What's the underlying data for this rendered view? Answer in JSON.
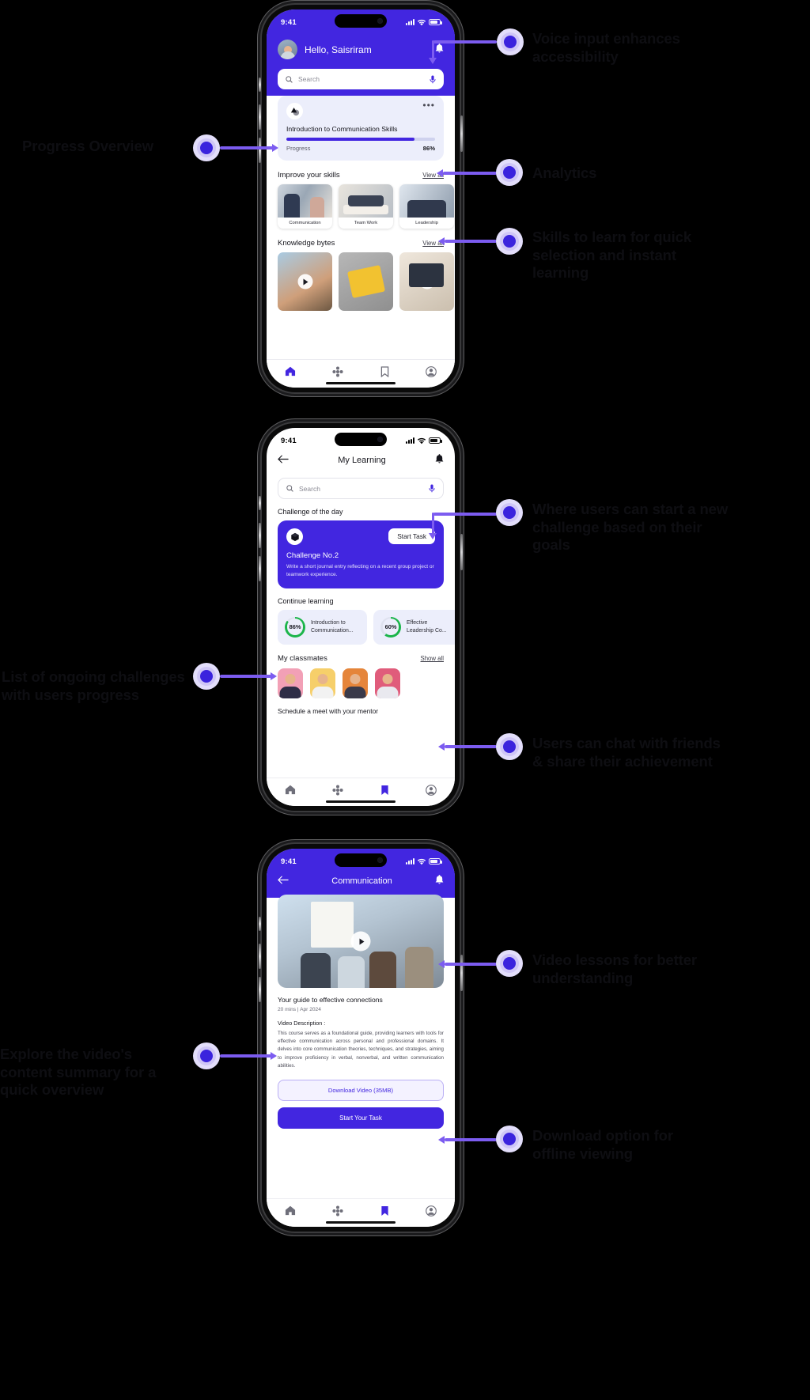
{
  "statusbar": {
    "time": "9:41"
  },
  "screen1": {
    "greeting": "Hello, Saisriram",
    "search_placeholder": "Search",
    "progress_card": {
      "title": "Introduction to Communication Skills",
      "progress_label": "Progress",
      "progress_value": "86%",
      "progress_percent": 86,
      "menu_icon": "more-horizontal-icon"
    },
    "skills_section": {
      "title": "Improve your skills",
      "link": "View all"
    },
    "skills": [
      {
        "caption": "Communication"
      },
      {
        "caption": "Team Work"
      },
      {
        "caption": "Leadership"
      }
    ],
    "bytes_section": {
      "title": "Knowledge bytes",
      "link": "View all"
    },
    "bytes": [
      {
        "caption": ""
      },
      {
        "caption": ""
      },
      {
        "caption": ""
      }
    ],
    "nav": [
      {
        "name": "home",
        "icon": "home-icon",
        "active": true
      },
      {
        "name": "explore",
        "icon": "flower-icon",
        "active": false
      },
      {
        "name": "bookmarks",
        "icon": "bookmark-icon",
        "active": false
      },
      {
        "name": "profile",
        "icon": "person-icon",
        "active": false
      }
    ]
  },
  "screen2": {
    "title": "My Learning",
    "back_icon": "arrow-left-icon",
    "bell_icon": "bell-icon",
    "search_placeholder": "Search",
    "challenge_section_label": "Challenge of the day",
    "challenge": {
      "icon": "cube-icon",
      "button": "Start Task",
      "number": "Challenge No.2",
      "description": "Write a short journal entry reflecting on a recent group project or teamwork experience."
    },
    "continue_label": "Continue learning",
    "continue_items": [
      {
        "percent": "86%",
        "value": 86,
        "title": "Introduction to Communication..."
      },
      {
        "percent": "60%",
        "value": 60,
        "title": "Effective Leadership Co..."
      }
    ],
    "classmates_label": "My classmates",
    "classmates_link": "Show all",
    "classmates": [
      {
        "id": "1"
      },
      {
        "id": "2"
      },
      {
        "id": "3"
      },
      {
        "id": "4"
      }
    ],
    "mentor_label": "Schedule a meet with your mentor",
    "nav": [
      {
        "name": "home",
        "icon": "home-icon",
        "active": false
      },
      {
        "name": "explore",
        "icon": "flower-icon",
        "active": false
      },
      {
        "name": "bookmarks",
        "icon": "bookmark-icon",
        "active": true
      },
      {
        "name": "profile",
        "icon": "person-icon",
        "active": false
      }
    ]
  },
  "screen3": {
    "title": "Communication",
    "back_icon": "arrow-left-icon",
    "bell_icon": "bell-icon",
    "video_play_icon": "play-icon",
    "video_title": "Your guide to effective connections",
    "video_meta": "20 mins | Apr 2024",
    "description_label": "Video Description :",
    "description": "This course serves as a foundational guide, providing learners with tools for effective communication across personal and professional domains. It delves into core communication theories, techniques, and strategies, aiming to improve proficiency in verbal, nonverbal, and written communication abilities.",
    "download_button": "Download Video (35MB)",
    "cta_button": "Start Your Task",
    "nav": [
      {
        "name": "home",
        "icon": "home-icon",
        "active": false
      },
      {
        "name": "explore",
        "icon": "flower-icon",
        "active": false
      },
      {
        "name": "bookmarks",
        "icon": "bookmark-icon",
        "active": true
      },
      {
        "name": "profile",
        "icon": "person-icon",
        "active": false
      }
    ]
  },
  "annotations": [
    {
      "id": "voice-input",
      "text": "Voice input enhances accessibility"
    },
    {
      "id": "progress-overview",
      "text": "Progress Overview"
    },
    {
      "id": "analytics",
      "text": "Analytics"
    },
    {
      "id": "skills-learn",
      "text": "Skills to learn for quick selection and instant learning"
    },
    {
      "id": "new-challenge",
      "text": "Where users can start a new challenge based on their goals"
    },
    {
      "id": "ongoing-challenges",
      "text": "List of ongoing challenges with users progress"
    },
    {
      "id": "chat-friends",
      "text": "Users can chat with friends & share their achievement"
    },
    {
      "id": "video-lessons",
      "text": "Video lessons for better understanding"
    },
    {
      "id": "content-summary",
      "text": "Explore the video's content summary for a quick overview"
    },
    {
      "id": "download-offline",
      "text": "Download option for offline viewing"
    }
  ],
  "colors": {
    "brand": "#4226E0",
    "accent": "#7c5cf0",
    "dot": "#3a23dd",
    "card": "#eceefb"
  }
}
